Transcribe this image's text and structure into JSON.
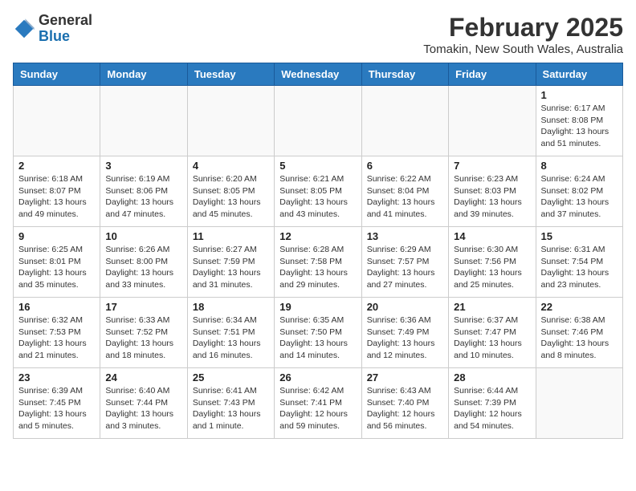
{
  "header": {
    "logo_general": "General",
    "logo_blue": "Blue",
    "month_year": "February 2025",
    "location": "Tomakin, New South Wales, Australia"
  },
  "weekdays": [
    "Sunday",
    "Monday",
    "Tuesday",
    "Wednesday",
    "Thursday",
    "Friday",
    "Saturday"
  ],
  "weeks": [
    [
      {
        "day": "",
        "info": ""
      },
      {
        "day": "",
        "info": ""
      },
      {
        "day": "",
        "info": ""
      },
      {
        "day": "",
        "info": ""
      },
      {
        "day": "",
        "info": ""
      },
      {
        "day": "",
        "info": ""
      },
      {
        "day": "1",
        "info": "Sunrise: 6:17 AM\nSunset: 8:08 PM\nDaylight: 13 hours\nand 51 minutes."
      }
    ],
    [
      {
        "day": "2",
        "info": "Sunrise: 6:18 AM\nSunset: 8:07 PM\nDaylight: 13 hours\nand 49 minutes."
      },
      {
        "day": "3",
        "info": "Sunrise: 6:19 AM\nSunset: 8:06 PM\nDaylight: 13 hours\nand 47 minutes."
      },
      {
        "day": "4",
        "info": "Sunrise: 6:20 AM\nSunset: 8:05 PM\nDaylight: 13 hours\nand 45 minutes."
      },
      {
        "day": "5",
        "info": "Sunrise: 6:21 AM\nSunset: 8:05 PM\nDaylight: 13 hours\nand 43 minutes."
      },
      {
        "day": "6",
        "info": "Sunrise: 6:22 AM\nSunset: 8:04 PM\nDaylight: 13 hours\nand 41 minutes."
      },
      {
        "day": "7",
        "info": "Sunrise: 6:23 AM\nSunset: 8:03 PM\nDaylight: 13 hours\nand 39 minutes."
      },
      {
        "day": "8",
        "info": "Sunrise: 6:24 AM\nSunset: 8:02 PM\nDaylight: 13 hours\nand 37 minutes."
      }
    ],
    [
      {
        "day": "9",
        "info": "Sunrise: 6:25 AM\nSunset: 8:01 PM\nDaylight: 13 hours\nand 35 minutes."
      },
      {
        "day": "10",
        "info": "Sunrise: 6:26 AM\nSunset: 8:00 PM\nDaylight: 13 hours\nand 33 minutes."
      },
      {
        "day": "11",
        "info": "Sunrise: 6:27 AM\nSunset: 7:59 PM\nDaylight: 13 hours\nand 31 minutes."
      },
      {
        "day": "12",
        "info": "Sunrise: 6:28 AM\nSunset: 7:58 PM\nDaylight: 13 hours\nand 29 minutes."
      },
      {
        "day": "13",
        "info": "Sunrise: 6:29 AM\nSunset: 7:57 PM\nDaylight: 13 hours\nand 27 minutes."
      },
      {
        "day": "14",
        "info": "Sunrise: 6:30 AM\nSunset: 7:56 PM\nDaylight: 13 hours\nand 25 minutes."
      },
      {
        "day": "15",
        "info": "Sunrise: 6:31 AM\nSunset: 7:54 PM\nDaylight: 13 hours\nand 23 minutes."
      }
    ],
    [
      {
        "day": "16",
        "info": "Sunrise: 6:32 AM\nSunset: 7:53 PM\nDaylight: 13 hours\nand 21 minutes."
      },
      {
        "day": "17",
        "info": "Sunrise: 6:33 AM\nSunset: 7:52 PM\nDaylight: 13 hours\nand 18 minutes."
      },
      {
        "day": "18",
        "info": "Sunrise: 6:34 AM\nSunset: 7:51 PM\nDaylight: 13 hours\nand 16 minutes."
      },
      {
        "day": "19",
        "info": "Sunrise: 6:35 AM\nSunset: 7:50 PM\nDaylight: 13 hours\nand 14 minutes."
      },
      {
        "day": "20",
        "info": "Sunrise: 6:36 AM\nSunset: 7:49 PM\nDaylight: 13 hours\nand 12 minutes."
      },
      {
        "day": "21",
        "info": "Sunrise: 6:37 AM\nSunset: 7:47 PM\nDaylight: 13 hours\nand 10 minutes."
      },
      {
        "day": "22",
        "info": "Sunrise: 6:38 AM\nSunset: 7:46 PM\nDaylight: 13 hours\nand 8 minutes."
      }
    ],
    [
      {
        "day": "23",
        "info": "Sunrise: 6:39 AM\nSunset: 7:45 PM\nDaylight: 13 hours\nand 5 minutes."
      },
      {
        "day": "24",
        "info": "Sunrise: 6:40 AM\nSunset: 7:44 PM\nDaylight: 13 hours\nand 3 minutes."
      },
      {
        "day": "25",
        "info": "Sunrise: 6:41 AM\nSunset: 7:43 PM\nDaylight: 13 hours\nand 1 minute."
      },
      {
        "day": "26",
        "info": "Sunrise: 6:42 AM\nSunset: 7:41 PM\nDaylight: 12 hours\nand 59 minutes."
      },
      {
        "day": "27",
        "info": "Sunrise: 6:43 AM\nSunset: 7:40 PM\nDaylight: 12 hours\nand 56 minutes."
      },
      {
        "day": "28",
        "info": "Sunrise: 6:44 AM\nSunset: 7:39 PM\nDaylight: 12 hours\nand 54 minutes."
      },
      {
        "day": "",
        "info": ""
      }
    ]
  ]
}
